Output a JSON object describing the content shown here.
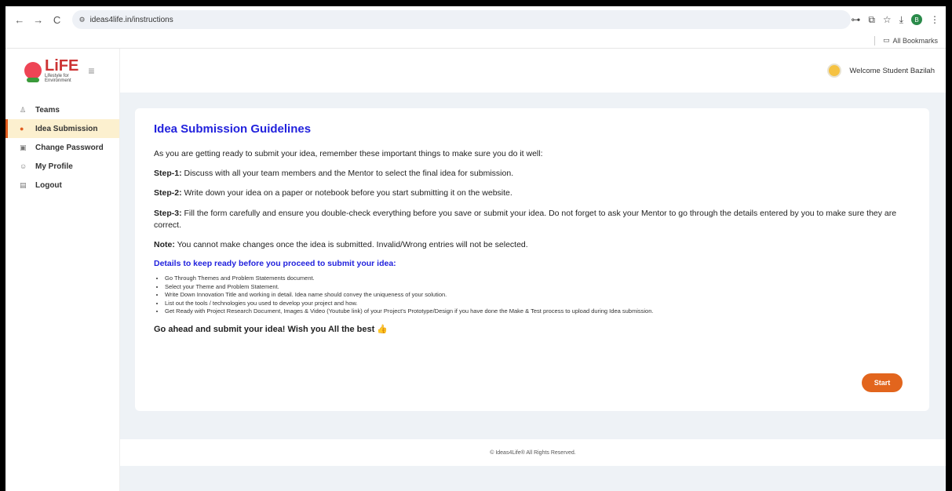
{
  "browser": {
    "url": "ideas4life.in/instructions",
    "back_icon": "←",
    "forward_icon": "→",
    "reload_icon": "C",
    "site_settings_icon": "⚙",
    "actions": [
      "⊶",
      "⧉",
      "☆",
      "⤓"
    ],
    "profile_initial": "B",
    "menu_icon": "⋮",
    "bookmarks_label": "All Bookmarks",
    "folder_icon": "▭"
  },
  "sidebar": {
    "logo_title": "LiFE",
    "logo_subtitle_1": "Lifestyle for",
    "logo_subtitle_2": "Environment",
    "hamburger_icon": "≡",
    "items": [
      {
        "label": "Teams",
        "icon": "♙"
      },
      {
        "label": "Idea Submission",
        "icon": "●"
      },
      {
        "label": "Change Password",
        "icon": "▣"
      },
      {
        "label": "My Profile",
        "icon": "☺"
      },
      {
        "label": "Logout",
        "icon": "▤"
      }
    ]
  },
  "header": {
    "welcome": "Welcome Student Bazilah"
  },
  "content": {
    "title": "Idea Submission Guidelines",
    "intro": "As you are getting ready to submit your idea, remember these important things to make sure you do it well:",
    "step1_label": "Step-1:",
    "step1_text": " Discuss with all your team members and the Mentor to select the final idea for submission.",
    "step2_label": "Step-2:",
    "step2_text": " Write down your idea on a paper or notebook before you start submitting it on the website.",
    "step3_label": "Step-3:",
    "step3_text": " Fill the form carefully and ensure you double-check everything before you save or submit your idea. Do not forget to ask your Mentor to go through the details entered by you to make sure they are correct.",
    "note_label": "Note:",
    "note_text": " You cannot make changes once the idea is submitted. Invalid/Wrong entries will not be selected.",
    "details_heading": "Details to keep ready before you proceed to submit your idea:",
    "bullets": [
      "Go Through Themes and Problem Statements document.",
      "Select your Theme and Problem Statement.",
      "Write Down Innovation Title and working in detail. Idea name should convey the uniqueness of your solution.",
      "List out the tools / technologies you used to develop your project and how.",
      "Get Ready with Project Research Document, Images & Video (Youtube link) of your Project's Prototype/Design if you have done the Make & Test process to upload during Idea submission."
    ],
    "closing": "Go ahead and submit your idea! Wish you All the best",
    "closing_icon": "👍",
    "start_label": "Start"
  },
  "footer": {
    "text": "© Ideas4Life® All Rights Reserved."
  },
  "colors": {
    "accent": "#e2651d",
    "heading_blue": "#2222dd",
    "active_bg": "#fcf0cf"
  }
}
